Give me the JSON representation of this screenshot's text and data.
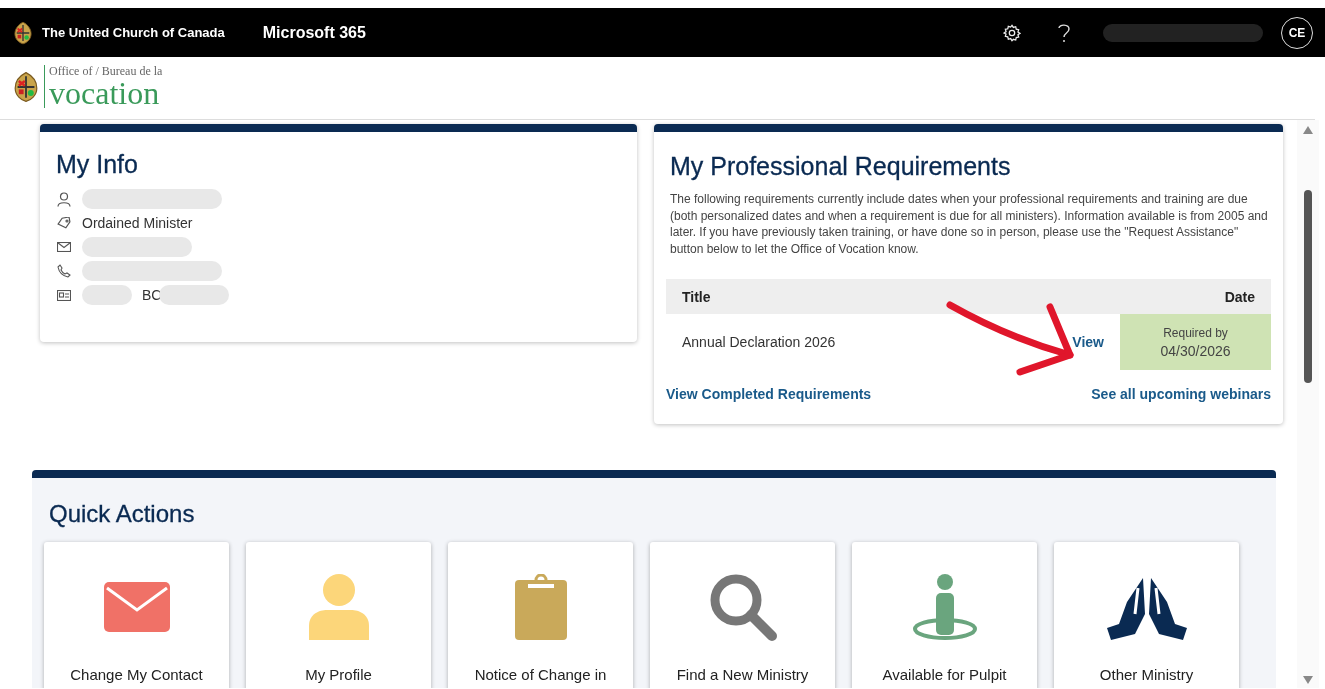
{
  "top_bar": {
    "org_name": "The United Church of Canada",
    "app_name": "Microsoft 365",
    "avatar_initials": "CE"
  },
  "header": {
    "logo_small": "Office of / Bureau de la",
    "logo_large": "vocation"
  },
  "my_info": {
    "title": "My Info",
    "rows": [
      {
        "kind": "person",
        "redacted": true
      },
      {
        "kind": "tag",
        "text": "Ordained Minister",
        "redacted": false
      },
      {
        "kind": "mail",
        "redacted": true
      },
      {
        "kind": "phone",
        "redacted": true
      },
      {
        "kind": "id-card",
        "text": "BC",
        "redacted": true
      }
    ]
  },
  "requirements": {
    "title": "My Professional Requirements",
    "description": "The following requirements currently include dates when your professional requirements and training are due (both personalized dates and when a requirement is due for all ministers). Information available is from 2005 and later. If you have previously taken training, or have done so in person, please use the \"Request Assistance\" button below to let the Office of Vocation know.",
    "columns": [
      "Title",
      "Date"
    ],
    "rows": [
      {
        "title": "Annual Declaration 2026",
        "link": "View",
        "due_label": "Required by",
        "due_date": "04/30/2026"
      }
    ],
    "links": [
      "View Completed Requirements",
      "See all upcoming webinars"
    ]
  },
  "quick_actions": {
    "title": "Quick Actions",
    "tiles": [
      {
        "kind": "envelope",
        "label": "Change My Contact"
      },
      {
        "kind": "person",
        "label": "My Profile"
      },
      {
        "kind": "clipboard",
        "label": "Notice of Change in"
      },
      {
        "kind": "search",
        "label": "Find a New Ministry"
      },
      {
        "kind": "standing-person",
        "label": "Available for Pulpit"
      },
      {
        "kind": "praying-hands",
        "label": "Other Ministry"
      }
    ]
  }
}
